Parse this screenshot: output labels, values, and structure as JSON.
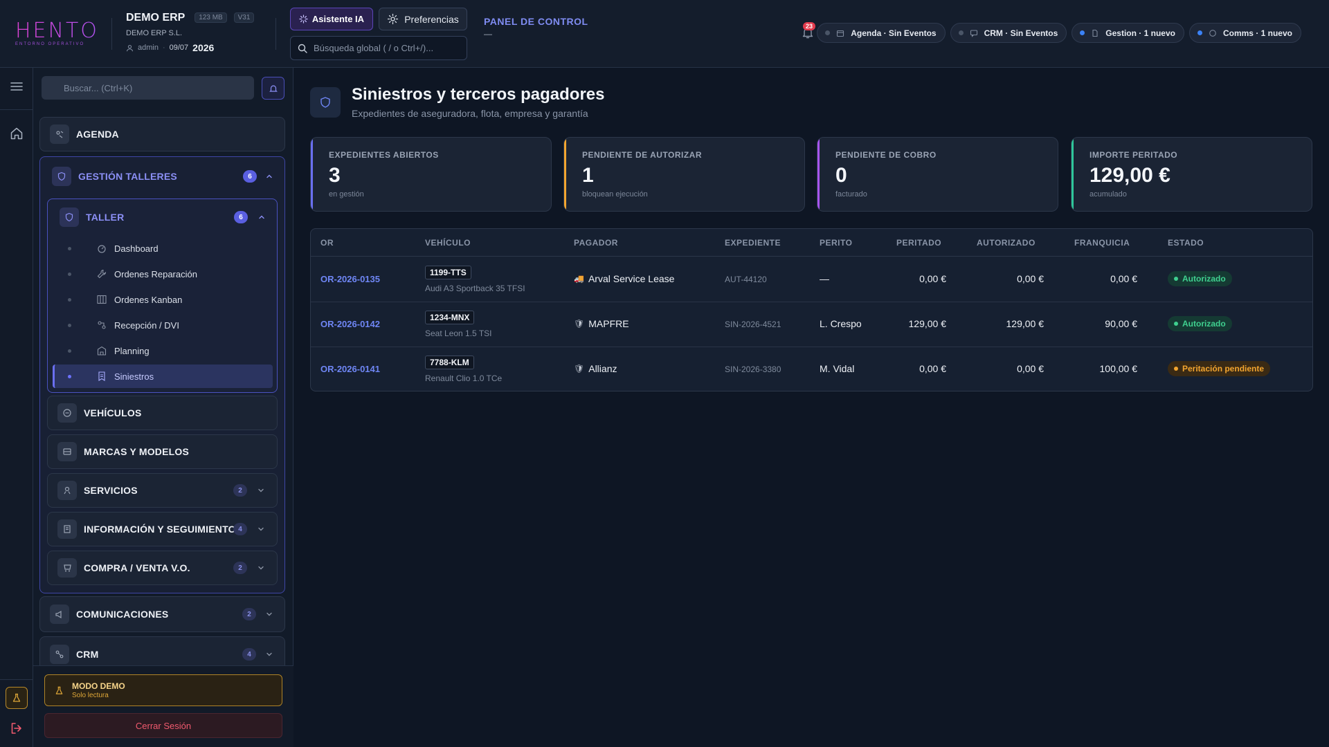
{
  "brand": {
    "logo_text": "HENTOP",
    "logo_sub": "ENTORNO OPERATIVO"
  },
  "company": {
    "name": "DEMO ERP",
    "size": "123 MB",
    "version": "V31",
    "legal": "DEMO ERP S.L.",
    "user": "admin",
    "date": "09/07",
    "year": "2026"
  },
  "toolbar": {
    "ai_label": "Asistente IA",
    "prefs_label": "Preferencias",
    "search_placeholder": "Búsqueda global ( / o Ctrl+/)..."
  },
  "panel": {
    "title": "PANEL DE CONTROL",
    "subtitle": "—"
  },
  "notifications": {
    "count": "23"
  },
  "status_pills": [
    {
      "label": "Agenda · Sin Eventos",
      "icon": "calendar-icon",
      "dot": "gray"
    },
    {
      "label": "CRM · Sin Eventos",
      "icon": "chat-icon",
      "dot": "gray"
    },
    {
      "label": "Gestion · 1 nuevo",
      "icon": "document-icon",
      "dot": "blue"
    },
    {
      "label": "Comms · 1 nuevo",
      "icon": "message-icon",
      "dot": "blue"
    }
  ],
  "sidebar": {
    "search_placeholder": "Buscar... (Ctrl+K)",
    "agenda": "AGENDA",
    "gestion": {
      "label": "GESTIÓN TALLERES",
      "count": "6"
    },
    "taller": {
      "label": "TALLER",
      "count": "6"
    },
    "taller_items": [
      {
        "label": "Dashboard",
        "icon": "gauge-icon"
      },
      {
        "label": "Ordenes Reparación",
        "icon": "wrench-icon"
      },
      {
        "label": "Ordenes Kanban",
        "icon": "kanban-icon"
      },
      {
        "label": "Recepción / DVI",
        "icon": "clipboard-icon"
      },
      {
        "label": "Planning",
        "icon": "building-icon"
      },
      {
        "label": "Siniestros",
        "icon": "file-icon"
      }
    ],
    "vehiculos": "VEHÍCULOS",
    "marcas": "MARCAS Y MODELOS",
    "servicios": {
      "label": "SERVICIOS",
      "count": "2"
    },
    "info": {
      "label": "INFORMACIÓN Y SEGUIMIENTO",
      "count": "4"
    },
    "compra": {
      "label": "COMPRA / VENTA V.O.",
      "count": "2"
    },
    "comunicaciones": {
      "label": "COMUNICACIONES",
      "count": "2"
    },
    "crm": {
      "label": "CRM",
      "count": "4"
    },
    "demo_title": "MODO DEMO",
    "demo_sub": "Solo lectura",
    "logout": "Cerrar Sesión"
  },
  "page": {
    "title": "Siniestros y terceros pagadores",
    "subtitle": "Expedientes de aseguradora, flota, empresa y garantía"
  },
  "kpis": [
    {
      "label": "EXPEDIENTES ABIERTOS",
      "value": "3",
      "sub": "en gestión",
      "color": "#6a6ff0"
    },
    {
      "label": "PENDIENTE DE AUTORIZAR",
      "value": "1",
      "sub": "bloquean ejecución",
      "color": "#f3a52f"
    },
    {
      "label": "PENDIENTE DE COBRO",
      "value": "0",
      "sub": "facturado",
      "color": "#a855f7"
    },
    {
      "label": "IMPORTE PERITADO",
      "value": "129,00 €",
      "sub": "acumulado",
      "color": "#2fc79a"
    }
  ],
  "table": {
    "headers": [
      "OR",
      "VEHÍCULO",
      "PAGADOR",
      "EXPEDIENTE",
      "PERITO",
      "PERITADO",
      "AUTORIZADO",
      "FRANQUICIA",
      "ESTADO"
    ],
    "rows": [
      {
        "or": "OR-2026-0135",
        "plate": "1199-TTS",
        "model": "Audi A3 Sportback 35 TFSI",
        "payer_icon": "🚚",
        "payer": "Arval Service Lease",
        "exp": "AUT-44120",
        "perito": "—",
        "peritado": "0,00 €",
        "autorizado": "0,00 €",
        "franquicia": "0,00 €",
        "estado": "Autorizado",
        "estado_kind": "ok"
      },
      {
        "or": "OR-2026-0142",
        "plate": "1234-MNX",
        "model": "Seat Leon 1.5 TSI",
        "payer_icon": "🛡",
        "payer": "MAPFRE",
        "exp": "SIN-2026-4521",
        "perito": "L. Crespo",
        "peritado": "129,00 €",
        "autorizado": "129,00 €",
        "franquicia": "90,00 €",
        "estado": "Autorizado",
        "estado_kind": "ok"
      },
      {
        "or": "OR-2026-0141",
        "plate": "7788-KLM",
        "model": "Renault Clio 1.0 TCe",
        "payer_icon": "🛡",
        "payer": "Allianz",
        "exp": "SIN-2026-3380",
        "perito": "M. Vidal",
        "peritado": "0,00 €",
        "autorizado": "0,00 €",
        "franquicia": "100,00 €",
        "estado": "Peritación pendiente",
        "estado_kind": "pend"
      }
    ]
  }
}
